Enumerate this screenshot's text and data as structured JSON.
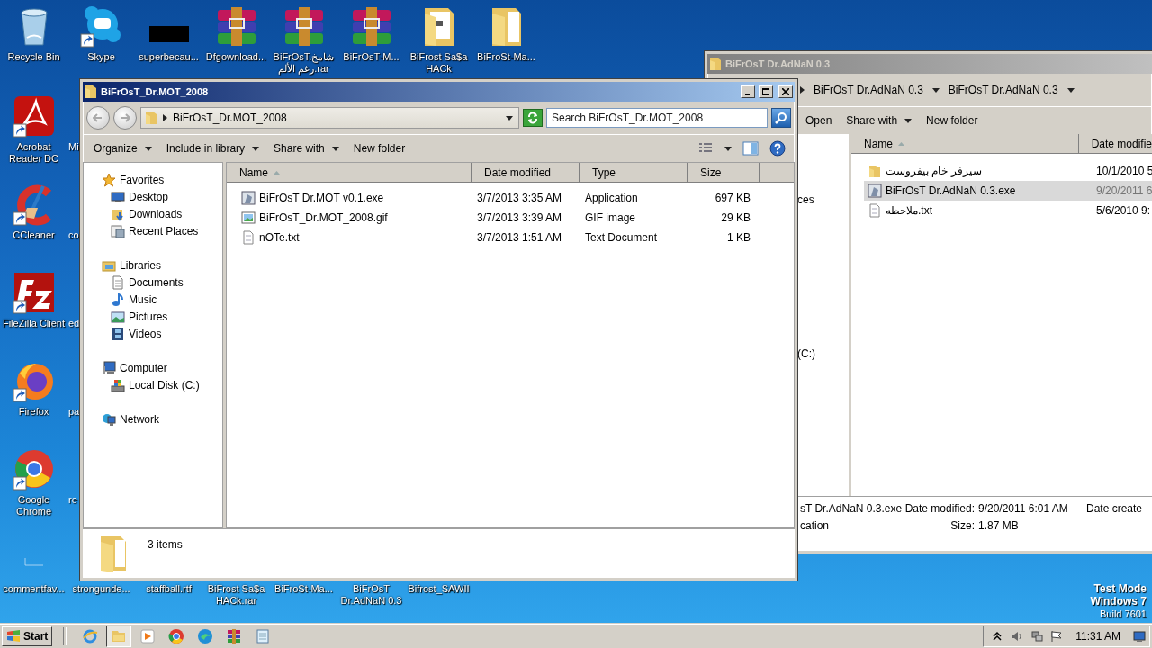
{
  "desktop": {
    "top_row": [
      {
        "label": "Recycle Bin",
        "kind": "recycle",
        "shortcut": false
      },
      {
        "label": "Skype",
        "kind": "chat",
        "shortcut": true
      },
      {
        "label": "superbecau...",
        "kind": "dark-thumb",
        "shortcut": false
      },
      {
        "label": "Dfgownload...",
        "kind": "archive",
        "shortcut": false
      },
      {
        "label": "BiFrOsT.شامخ رغم الألم.rar",
        "kind": "archive",
        "shortcut": false
      },
      {
        "label": "BiFrOsT-M...",
        "kind": "archive",
        "shortcut": false
      },
      {
        "label": "BiFrost Sa$a HACk",
        "kind": "folder-doc",
        "shortcut": false
      },
      {
        "label": "BiFroSt-Ma...",
        "kind": "folder",
        "shortcut": false
      }
    ],
    "left_column": [
      {
        "label": "Acrobat Reader DC",
        "kind": "pdf",
        "shortcut": true
      },
      {
        "label": "CCleaner",
        "kind": "cleaner",
        "shortcut": true
      },
      {
        "label": "FileZilla Client",
        "kind": "ftp",
        "shortcut": true
      },
      {
        "label": "Firefox",
        "kind": "fox",
        "shortcut": true
      },
      {
        "label": "Google Chrome",
        "kind": "browser",
        "shortcut": true
      }
    ],
    "second_column_labels": [
      "Mi",
      "co",
      "ed",
      "pa",
      "re"
    ],
    "bottom_row": [
      {
        "label": "commentfav...",
        "kind": "blank"
      },
      {
        "label": "strongunde..."
      },
      {
        "label": "staffball.rtf"
      },
      {
        "label": "BiFrost Sa$a HACk.rar"
      },
      {
        "label": "BiFroSt-Ma..."
      },
      {
        "label": "BiFrOsT Dr.AdNaN 0.3"
      },
      {
        "label": "Bifrost_SAWII"
      }
    ],
    "os_notice": [
      "Test Mode",
      "Windows 7",
      "Build 7601"
    ]
  },
  "back_window": {
    "title": "BiFrOsT Dr.AdNaN 0.3",
    "breadcrumb": [
      "BiFrOsT Dr.AdNaN 0.3",
      "BiFrOsT Dr.AdNaN 0.3"
    ],
    "commands": [
      {
        "label": "Open",
        "menu": false
      },
      {
        "label": "Share with",
        "menu": true
      },
      {
        "label": "New folder",
        "menu": false
      }
    ],
    "nav_fragments": [
      "ces",
      "(C:)"
    ],
    "columns": [
      {
        "label": "Name",
        "sorted": true
      },
      {
        "label": "Date modifie",
        "sorted": false
      }
    ],
    "rows": [
      {
        "name": "سيرفر خام بيفروست",
        "date": "10/1/2010 5",
        "kind": "folder",
        "selected": false
      },
      {
        "name": "BiFrOsT Dr.AdNaN 0.3.exe",
        "date": "9/20/2011 6",
        "kind": "exe",
        "selected": true
      },
      {
        "name": "ملاحظه.txt",
        "date": "5/6/2010 9:",
        "kind": "text",
        "selected": false
      }
    ],
    "details": {
      "name": "sT Dr.AdNaN 0.3.exe",
      "type": "cation",
      "fields": [
        {
          "label": "Date modified:",
          "value": "9/20/2011 6:01 AM"
        },
        {
          "label": "Size:",
          "value": "1.87 MB"
        }
      ],
      "extra_label": "Date create"
    }
  },
  "front_window": {
    "title": "BiFrOsT_Dr.MOT_2008",
    "path": "BiFrOsT_Dr.MOT_2008",
    "search": {
      "placeholder": "Search BiFrOsT_Dr.MOT_2008"
    },
    "commands": [
      {
        "label": "Organize",
        "menu": true
      },
      {
        "label": "Include in library",
        "menu": true
      },
      {
        "label": "Share with",
        "menu": true
      },
      {
        "label": "New folder",
        "menu": false
      }
    ],
    "nav": [
      {
        "label": "Favorites",
        "kind": "star",
        "children": [
          {
            "label": "Desktop",
            "kind": "desktop"
          },
          {
            "label": "Downloads",
            "kind": "downloads"
          },
          {
            "label": "Recent Places",
            "kind": "recent"
          }
        ]
      },
      {
        "label": "Libraries",
        "kind": "library",
        "children": [
          {
            "label": "Documents",
            "kind": "document"
          },
          {
            "label": "Music",
            "kind": "music"
          },
          {
            "label": "Pictures",
            "kind": "pictures"
          },
          {
            "label": "Videos",
            "kind": "videos"
          }
        ]
      },
      {
        "label": "Computer",
        "kind": "computer",
        "children": [
          {
            "label": "Local Disk (C:)",
            "kind": "disk"
          }
        ]
      },
      {
        "label": "Network",
        "kind": "network"
      }
    ],
    "columns": [
      {
        "label": "Name",
        "sorted": true
      },
      {
        "label": "Date modified",
        "sorted": false
      },
      {
        "label": "Type",
        "sorted": false
      },
      {
        "label": "Size",
        "sorted": false
      }
    ],
    "rows": [
      {
        "name": "BiFrOsT Dr.MOT v0.1.exe",
        "date": "3/7/2013 3:35 AM",
        "type": "Application",
        "size": "697 KB",
        "kind": "exe"
      },
      {
        "name": "BiFrOsT_Dr.MOT_2008.gif",
        "date": "3/7/2013 3:39 AM",
        "type": "GIF image",
        "size": "29 KB",
        "kind": "image"
      },
      {
        "name": "nOTe.txt",
        "date": "3/7/2013 1:51 AM",
        "type": "Text Document",
        "size": "1 KB",
        "kind": "text"
      }
    ],
    "summary": "3 items"
  },
  "taskbar": {
    "start": "Start",
    "apps": [
      {
        "kind": "ie",
        "active": false
      },
      {
        "kind": "explorer",
        "active": true
      },
      {
        "kind": "media",
        "active": false
      },
      {
        "kind": "browser",
        "active": false
      },
      {
        "kind": "edge",
        "active": false
      },
      {
        "kind": "archive",
        "active": false
      },
      {
        "kind": "notepad",
        "active": false
      }
    ],
    "clock": "11:31 AM"
  }
}
